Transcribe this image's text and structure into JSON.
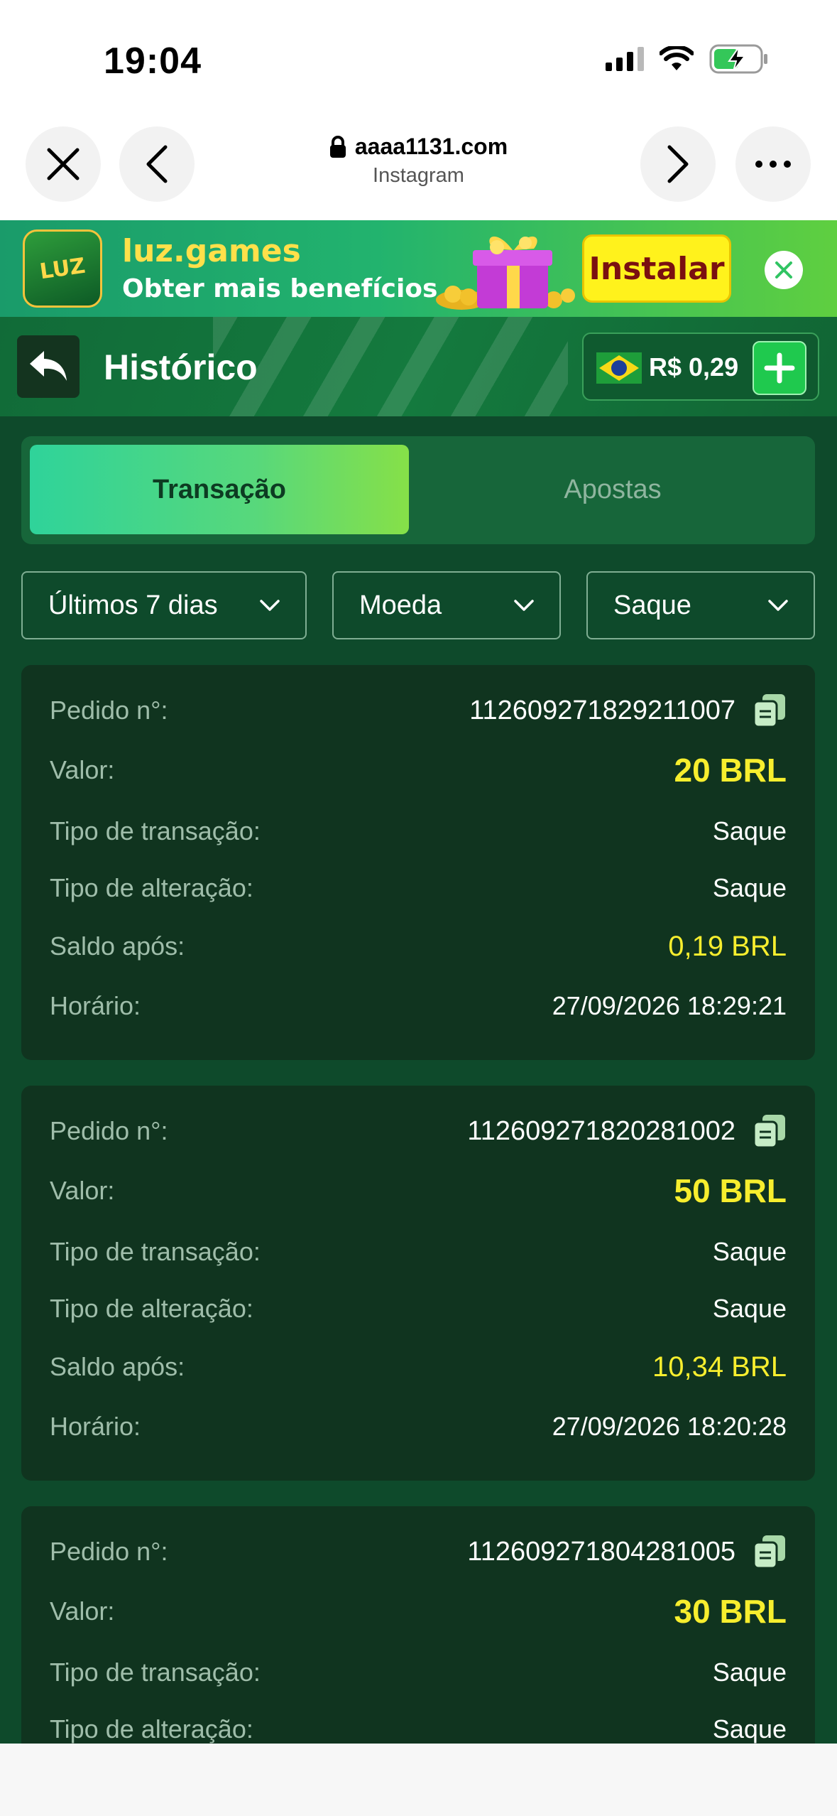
{
  "status_bar": {
    "time": "19:04"
  },
  "browser": {
    "domain": "aaaa1131.com",
    "subtitle": "Instagram"
  },
  "banner": {
    "logo_text": "LUZ",
    "title": "luz.games",
    "subtitle": "Obter mais benefícios",
    "install_label": "Instalar"
  },
  "header": {
    "title": "Histórico",
    "balance": "R$ 0,29"
  },
  "tabs": [
    {
      "label": "Transação",
      "active": true
    },
    {
      "label": "Apostas",
      "active": false
    }
  ],
  "filters": {
    "period": "Últimos 7 dias",
    "currency": "Moeda",
    "type": "Saque"
  },
  "labels": {
    "order": "Pedido n°:",
    "amount": "Valor:",
    "transaction_type": "Tipo de transação:",
    "change_type": "Tipo de alteração:",
    "balance_after": "Saldo após:",
    "time": "Horário:"
  },
  "records": [
    {
      "order": "112609271829211007",
      "amount": "20 BRL",
      "transaction_type": "Saque",
      "change_type": "Saque",
      "balance_after": "0,19 BRL",
      "time": "27/09/2026 18:29:21"
    },
    {
      "order": "112609271820281002",
      "amount": "50 BRL",
      "transaction_type": "Saque",
      "change_type": "Saque",
      "balance_after": "10,34 BRL",
      "time": "27/09/2026 18:20:28"
    },
    {
      "order": "112609271804281005",
      "amount": "30 BRL",
      "transaction_type": "Saque",
      "change_type": "Saque",
      "balance_after": "",
      "time": ""
    }
  ],
  "colors": {
    "app_background": "#0e4a2b",
    "card_background": "#10341f",
    "accent_yellow": "#f7ee2e",
    "active_tab_gradient_start": "#2fd39a",
    "active_tab_gradient_end": "#86e048"
  }
}
